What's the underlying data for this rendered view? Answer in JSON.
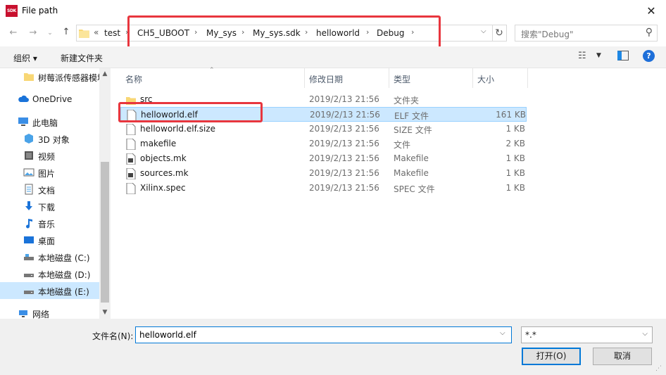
{
  "window": {
    "title": "File path",
    "app_badge": "SDK"
  },
  "nav": {
    "path": [
      "test",
      "CH5_UBOOT",
      "My_sys",
      "My_sys.sdk",
      "helloworld",
      "Debug"
    ],
    "overflow": "«",
    "search_placeholder": "搜索\"Debug\""
  },
  "toolbar": {
    "organize": "组织 ▾",
    "new_folder": "新建文件夹"
  },
  "sidebar": {
    "items": [
      {
        "label": "树莓派传感器模块",
        "icon": "folder-icon",
        "level": "sub"
      },
      {
        "label": "OneDrive",
        "icon": "cloud-icon",
        "level": "top"
      },
      {
        "label": "此电脑",
        "icon": "pc-icon",
        "level": "top"
      },
      {
        "label": "3D 对象",
        "icon": "cube-icon",
        "level": "sub"
      },
      {
        "label": "视频",
        "icon": "video-icon",
        "level": "sub"
      },
      {
        "label": "图片",
        "icon": "image-icon",
        "level": "sub"
      },
      {
        "label": "文档",
        "icon": "document-icon",
        "level": "sub"
      },
      {
        "label": "下载",
        "icon": "download-icon",
        "level": "sub"
      },
      {
        "label": "音乐",
        "icon": "music-icon",
        "level": "sub"
      },
      {
        "label": "桌面",
        "icon": "desktop-icon",
        "level": "sub"
      },
      {
        "label": "本地磁盘 (C:)",
        "icon": "drive-icon",
        "level": "sub"
      },
      {
        "label": "本地磁盘 (D:)",
        "icon": "drive-icon",
        "level": "sub"
      },
      {
        "label": "本地磁盘 (E:)",
        "icon": "drive-icon",
        "level": "sub",
        "selected": true
      },
      {
        "label": "网络",
        "icon": "network-icon",
        "level": "top"
      }
    ]
  },
  "columns": {
    "name": "名称",
    "date": "修改日期",
    "type": "类型",
    "size": "大小"
  },
  "files": [
    {
      "name": "src",
      "date": "2019/2/13 21:56",
      "type": "文件夹",
      "size": "",
      "icon": "folder-icon"
    },
    {
      "name": "helloworld.elf",
      "date": "2019/2/13 21:56",
      "type": "ELF 文件",
      "size": "161 KB",
      "icon": "file-icon",
      "selected": true
    },
    {
      "name": "helloworld.elf.size",
      "date": "2019/2/13 21:56",
      "type": "SIZE 文件",
      "size": "1 KB",
      "icon": "file-icon"
    },
    {
      "name": "makefile",
      "date": "2019/2/13 21:56",
      "type": "文件",
      "size": "2 KB",
      "icon": "file-icon"
    },
    {
      "name": "objects.mk",
      "date": "2019/2/13 21:56",
      "type": "Makefile",
      "size": "1 KB",
      "icon": "makefile-icon"
    },
    {
      "name": "sources.mk",
      "date": "2019/2/13 21:56",
      "type": "Makefile",
      "size": "1 KB",
      "icon": "makefile-icon"
    },
    {
      "name": "Xilinx.spec",
      "date": "2019/2/13 21:56",
      "type": "SPEC 文件",
      "size": "1 KB",
      "icon": "file-icon"
    }
  ],
  "footer": {
    "filename_label": "文件名(N):",
    "filename_value": "helloworld.elf",
    "filter_value": "*.*",
    "open_label": "打开(O)",
    "cancel_label": "取消"
  },
  "colors": {
    "selection": "#cce8ff",
    "highlight": "#e8363e",
    "accent": "#0078d7",
    "folder": "#f8d775"
  }
}
